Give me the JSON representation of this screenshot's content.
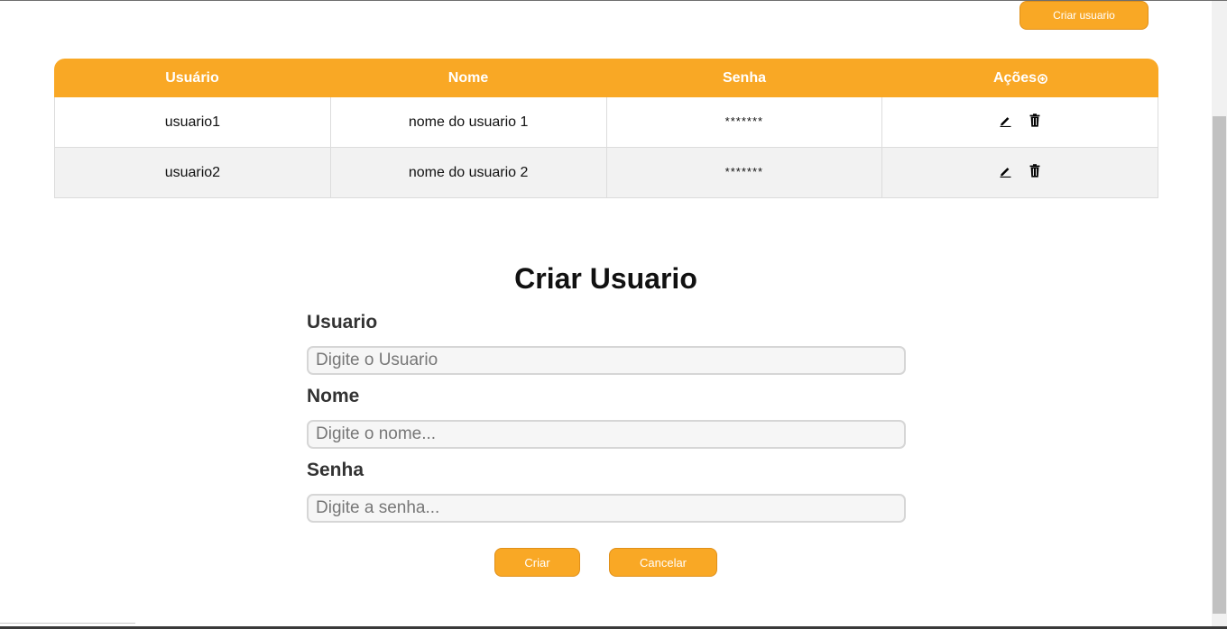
{
  "header": {
    "create_user_button": "Criar usuario"
  },
  "table": {
    "columns": [
      "Usuário",
      "Nome",
      "Senha",
      "Ações"
    ],
    "add_icon": "plus-circle-icon",
    "rows": [
      {
        "usuario": "usuario1",
        "nome": "nome do usuario 1",
        "senha": "*******",
        "edit_icon": "pencil-icon",
        "delete_icon": "trash-icon"
      },
      {
        "usuario": "usuario2",
        "nome": "nome do usuario 2",
        "senha": "*******",
        "edit_icon": "pencil-icon",
        "delete_icon": "trash-icon"
      }
    ]
  },
  "form": {
    "title": "Criar Usuario",
    "fields": [
      {
        "label": "Usuario",
        "placeholder": "Digite o Usuario",
        "value": ""
      },
      {
        "label": "Nome",
        "placeholder": "Digite o nome...",
        "value": ""
      },
      {
        "label": "Senha",
        "placeholder": "Digite a senha...",
        "value": ""
      }
    ],
    "submit_label": "Criar",
    "cancel_label": "Cancelar"
  },
  "colors": {
    "accent": "#f9a825",
    "row_alt": "#f2f2f2",
    "border": "#dcdcdc"
  }
}
